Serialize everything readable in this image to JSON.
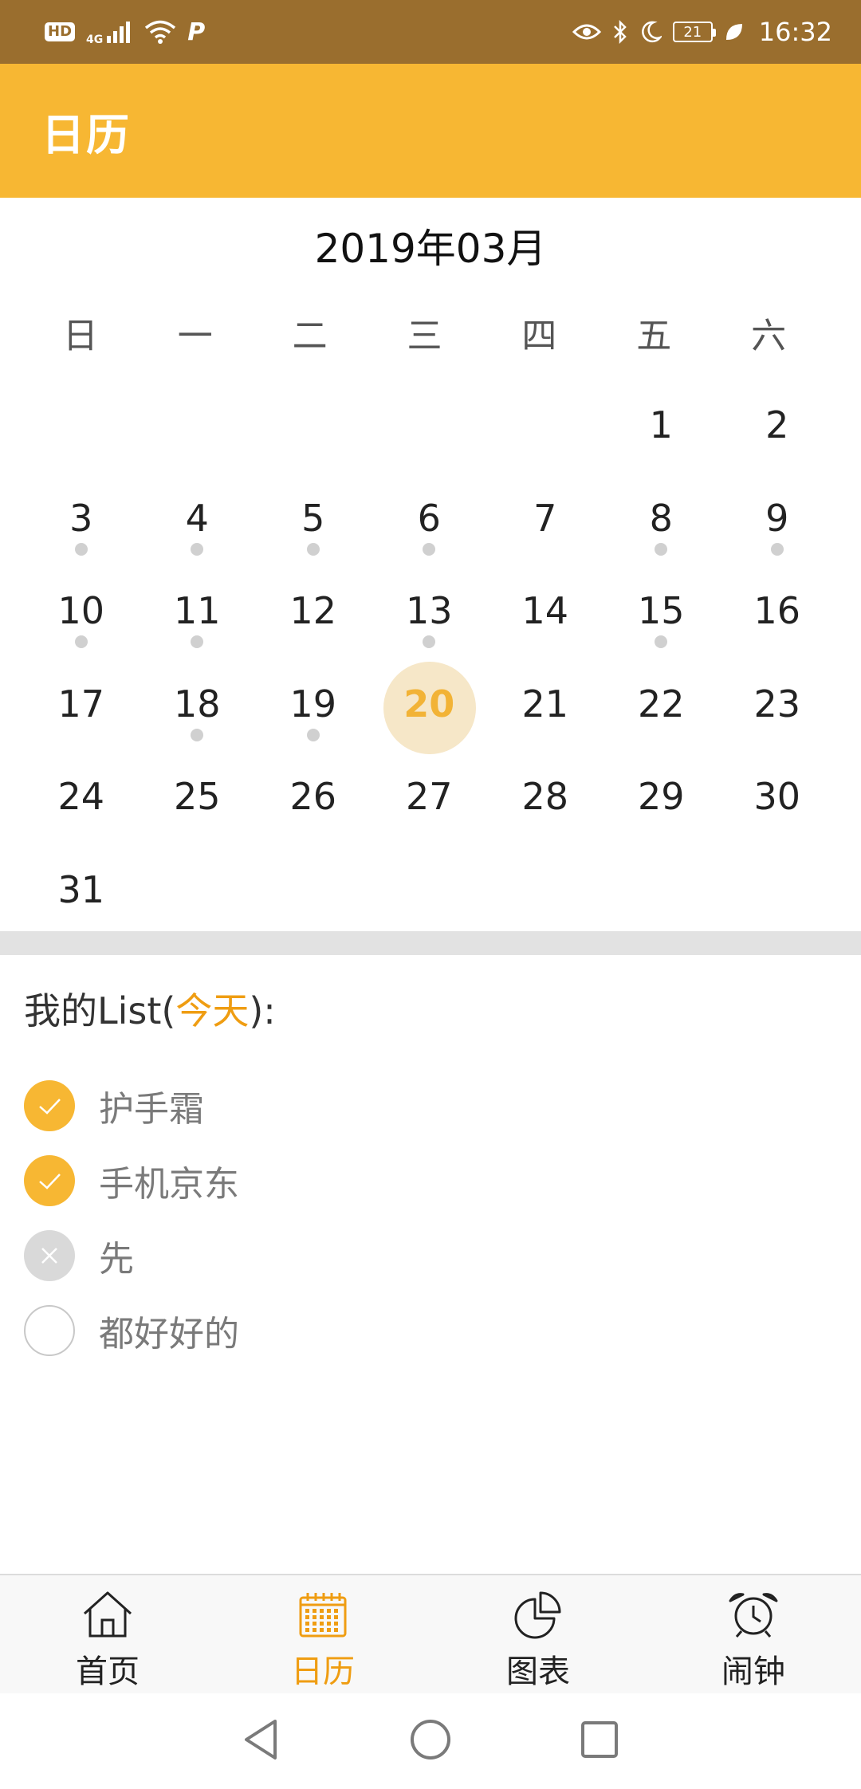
{
  "status_bar": {
    "hd": "HD",
    "network": "4G",
    "p_label": "P",
    "battery": "21",
    "time": "16:32"
  },
  "app_bar": {
    "title": "日历"
  },
  "calendar": {
    "month_title": "2019年03月",
    "weekdays": [
      "日",
      "一",
      "二",
      "三",
      "四",
      "五",
      "六"
    ],
    "leading_blanks": 5,
    "today": 20,
    "days": [
      {
        "d": "1",
        "dot": false
      },
      {
        "d": "2",
        "dot": false
      },
      {
        "d": "3",
        "dot": true
      },
      {
        "d": "4",
        "dot": true
      },
      {
        "d": "5",
        "dot": true
      },
      {
        "d": "6",
        "dot": true
      },
      {
        "d": "7",
        "dot": false
      },
      {
        "d": "8",
        "dot": true
      },
      {
        "d": "9",
        "dot": true
      },
      {
        "d": "10",
        "dot": true
      },
      {
        "d": "11",
        "dot": true
      },
      {
        "d": "12",
        "dot": false
      },
      {
        "d": "13",
        "dot": true
      },
      {
        "d": "14",
        "dot": false
      },
      {
        "d": "15",
        "dot": true
      },
      {
        "d": "16",
        "dot": false
      },
      {
        "d": "17",
        "dot": false
      },
      {
        "d": "18",
        "dot": true
      },
      {
        "d": "19",
        "dot": true
      },
      {
        "d": "20",
        "dot": false
      },
      {
        "d": "21",
        "dot": false
      },
      {
        "d": "22",
        "dot": false
      },
      {
        "d": "23",
        "dot": false
      },
      {
        "d": "24",
        "dot": false
      },
      {
        "d": "25",
        "dot": false
      },
      {
        "d": "26",
        "dot": false
      },
      {
        "d": "27",
        "dot": false
      },
      {
        "d": "28",
        "dot": false
      },
      {
        "d": "29",
        "dot": false
      },
      {
        "d": "30",
        "dot": false
      },
      {
        "d": "31",
        "dot": false
      }
    ]
  },
  "list": {
    "heading_prefix": "我的List(",
    "heading_highlight": "今天",
    "heading_suffix": "):",
    "items": [
      {
        "label": "护手霜",
        "state": "done"
      },
      {
        "label": "手机京东",
        "state": "done"
      },
      {
        "label": "先",
        "state": "cancelled"
      },
      {
        "label": "都好好的",
        "state": "pending"
      }
    ]
  },
  "bottom_nav": {
    "tabs": [
      {
        "label": "首页",
        "icon": "home-icon",
        "active": false
      },
      {
        "label": "日历",
        "icon": "calendar-icon",
        "active": true
      },
      {
        "label": "图表",
        "icon": "pie-chart-icon",
        "active": false
      },
      {
        "label": "闹钟",
        "icon": "alarm-clock-icon",
        "active": false
      }
    ]
  },
  "colors": {
    "status_bar": "#9a6e2e",
    "accent": "#f7b733",
    "accent_text": "#ef9d12",
    "today_bg": "#f6e7c8"
  }
}
